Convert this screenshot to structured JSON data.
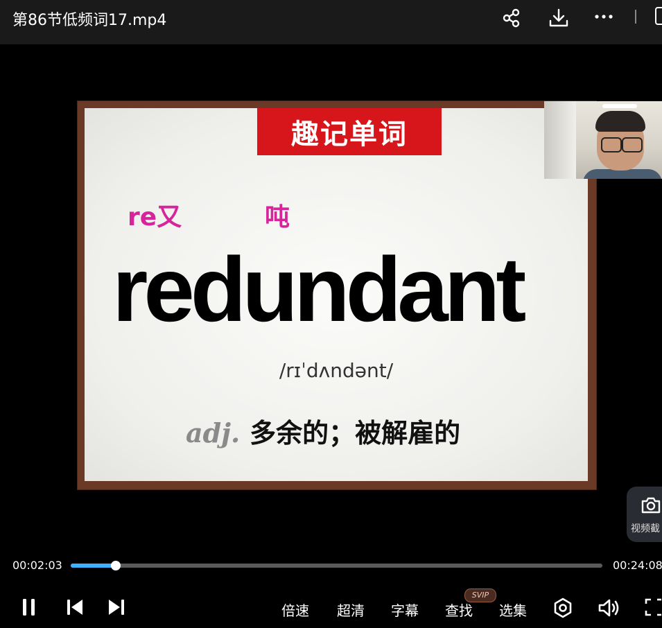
{
  "window": {
    "title": "第86节低频词17.mp4"
  },
  "toolbar": {
    "icons": [
      "share-icon",
      "download-icon",
      "more-icon"
    ]
  },
  "slide": {
    "banner": "趣记单词",
    "hint_left": "re又",
    "hint_right": "吨",
    "word": "redundant",
    "phonetic": "/rɪˈdʌndənt/",
    "pos": "adj.",
    "definition": "多余的；被解雇的"
  },
  "screenshot_button": {
    "label": "视频截"
  },
  "player": {
    "current_time": "00:02:03",
    "duration": "00:24:08",
    "progress": 0.085,
    "controls": {
      "speed": "倍速",
      "quality": "超清",
      "subtitles": "字幕",
      "search": "查找",
      "search_badge": "SVIP",
      "episodes": "选集"
    }
  },
  "colors": {
    "banner": "#d6161a",
    "hint": "#d6249a",
    "progress": "#3fb1ff",
    "board_frame": "#6b3a26"
  }
}
